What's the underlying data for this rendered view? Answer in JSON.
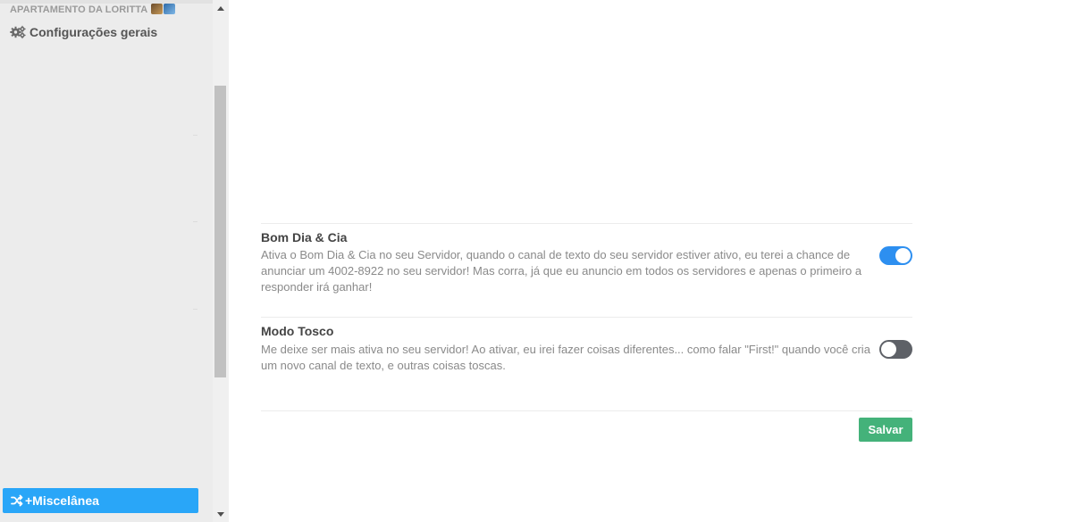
{
  "sidebar": {
    "server_name": "APARTAMENTO DA LORITTA",
    "server_emojis": [
      "emoji",
      "emoji"
    ],
    "config_item": {
      "icon": "gears-icon",
      "label": "Configurações gerais"
    },
    "active_item": {
      "icon": "shuffle-icon",
      "label": "+Miscelânea",
      "color": "#29a6f8"
    }
  },
  "settings": [
    {
      "title": "Bom Dia & Cia",
      "description": "Ativa o Bom Dia & Cia no seu Servidor, quando o canal de texto do seu servidor estiver ativo, eu terei a chance de anunciar um 4002-8922 no seu servidor! Mas corra, já que eu anuncio em todos os servidores e apenas o primeiro a responder irá ganhar!",
      "enabled": true
    },
    {
      "title": "Modo Tosco",
      "description": "Me deixe ser mais ativa no seu servidor! Ao ativar, eu irei fazer coisas diferentes... como falar \"First!\" quando você cria um novo canal de texto, e outras coisas toscas.",
      "enabled": false
    }
  ],
  "actions": {
    "save_label": "Salvar",
    "save_color": "#44b27a"
  },
  "colors": {
    "toggle_on": "#2d8ff0",
    "toggle_off": "#5e6167"
  }
}
